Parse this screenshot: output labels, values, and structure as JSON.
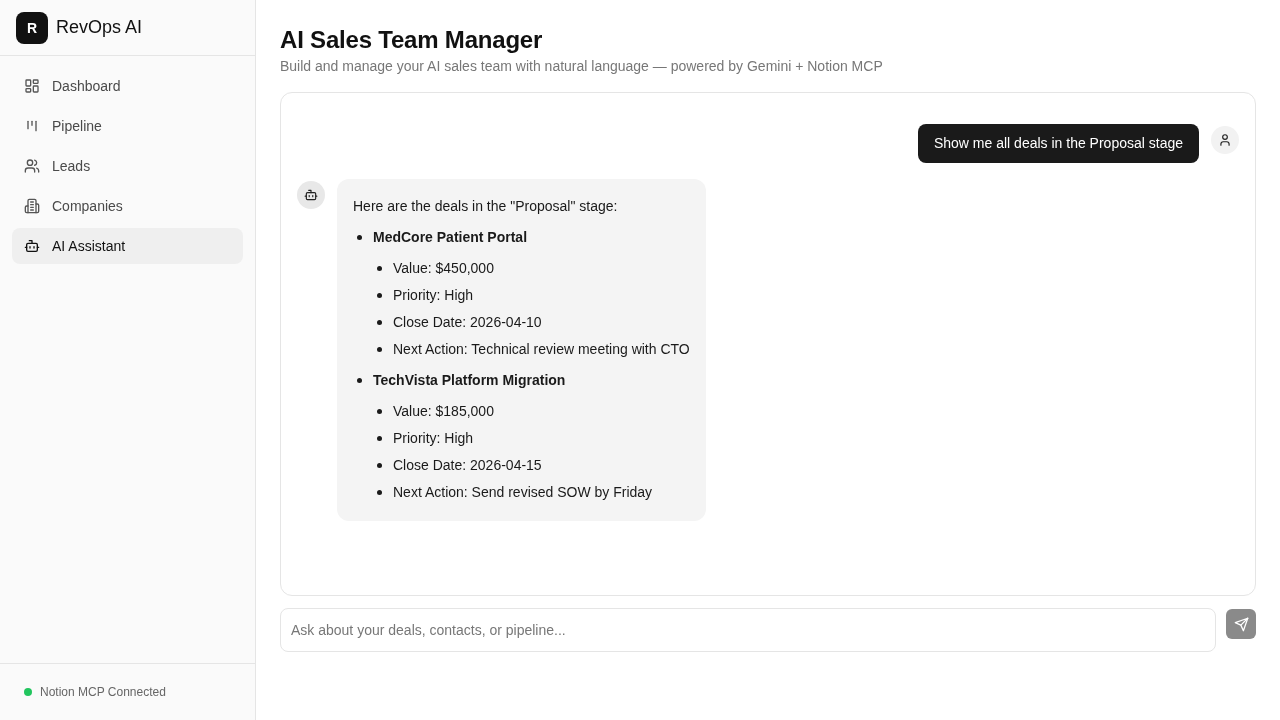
{
  "sidebar": {
    "logo": {
      "letter": "R",
      "name": "RevOps AI"
    },
    "nav_items": [
      {
        "label": "Dashboard",
        "selected": false
      },
      {
        "label": "Pipeline",
        "selected": false
      },
      {
        "label": "Leads",
        "selected": false
      },
      {
        "label": "Companies",
        "selected": false
      },
      {
        "label": "AI Assistant",
        "selected": true
      }
    ],
    "status": {
      "label": "Notion MCP Connected",
      "connected": true
    }
  },
  "header": {
    "title": "AI Sales Team Manager",
    "subtitle": "Build and manage your AI sales team with natural language — powered by Gemini + Notion MCP"
  },
  "chat": {
    "messages": [
      {
        "kind": "user",
        "text": "Show me all deals in the Proposal stage"
      },
      {
        "kind": "assistant",
        "intro": "Here are the deals in the \"Proposal\" stage:",
        "items": [
          {
            "title": "MedCore Patient Portal",
            "details": [
              "Value: $450,000",
              "Priority: High",
              "Close Date: 2026-04-10",
              "Next Action: Technical review meeting with CTO"
            ]
          },
          {
            "title": "TechVista Platform Migration",
            "details": [
              "Value: $185,000",
              "Priority: High",
              "Close Date: 2026-04-15",
              "Next Action: Send revised SOW by Friday"
            ]
          }
        ]
      }
    ]
  },
  "composer": {
    "placeholder": "Ask about your deals, contacts, or pipeline...",
    "send_button": {
      "disabled": true
    }
  }
}
